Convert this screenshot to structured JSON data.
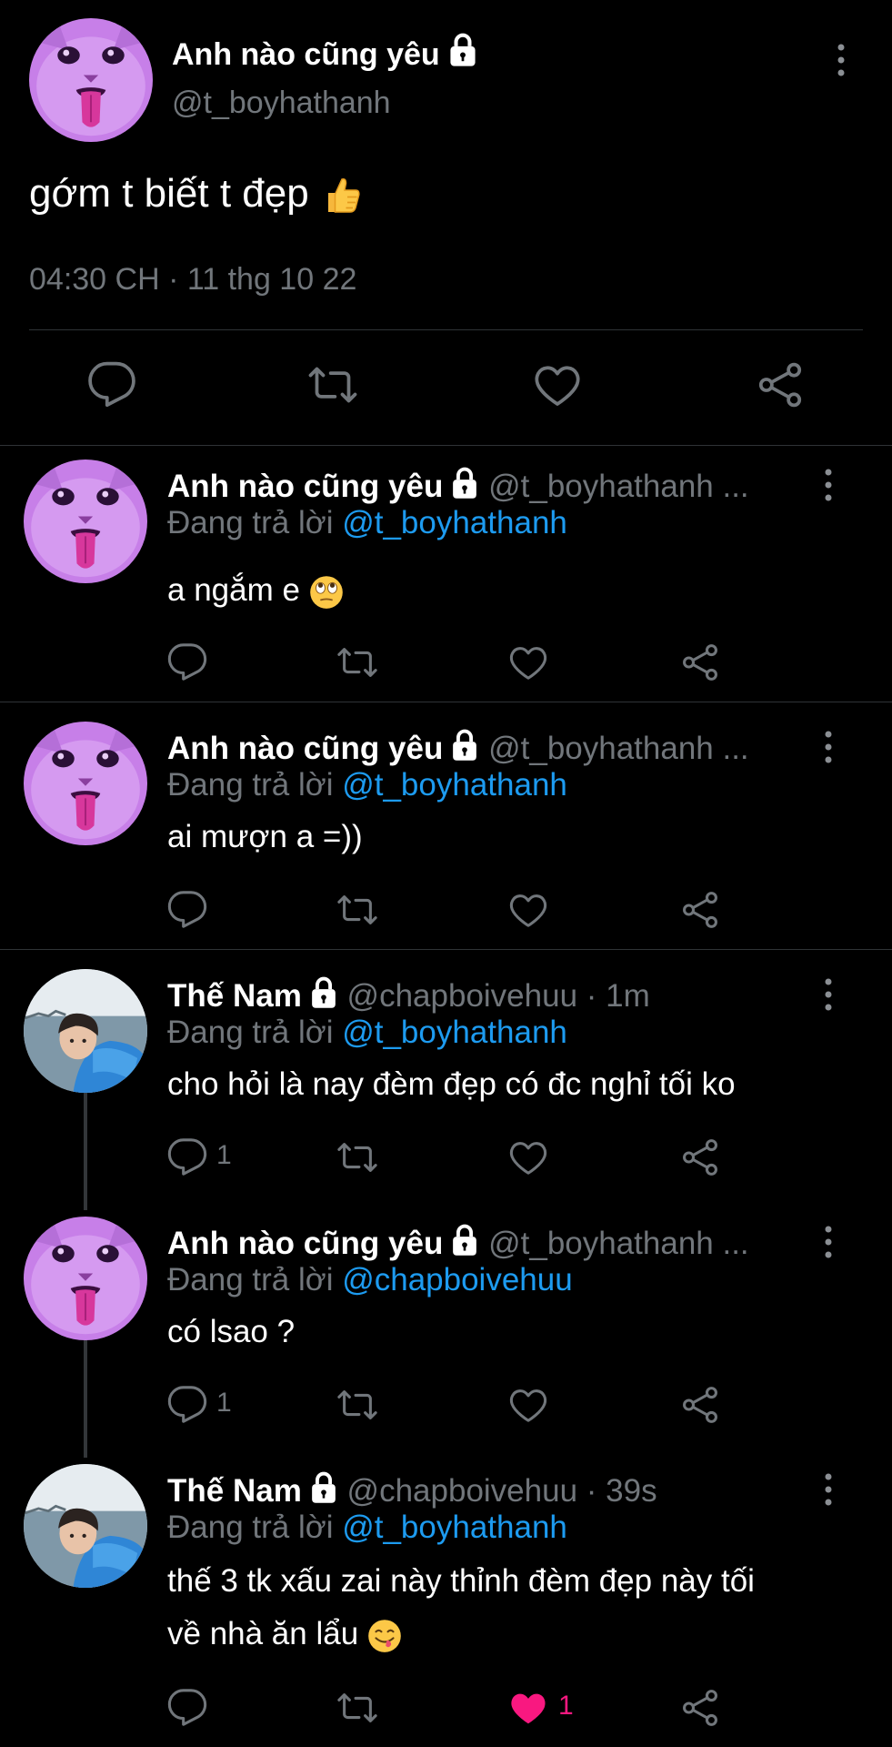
{
  "main_tweet": {
    "display_name": "Anh nào cũng yêu",
    "handle": "@t_boyhathanh",
    "text": "gớm t biết t đẹp",
    "timestamp": "04:30 CH · 11 thg 10 22",
    "actions": [
      "reply-icon",
      "retweet-icon",
      "like-icon",
      "share-icon"
    ]
  },
  "replies": [
    {
      "display_name": "Anh nào cũng yêu",
      "handle_meta": "@t_boyhathanh ...",
      "replying_prefix": "Đang trả lời",
      "replying_to": "@t_boyhathanh",
      "text": "a ngắm e",
      "reply_count": "",
      "like_count": ""
    },
    {
      "display_name": "Anh nào cũng yêu",
      "handle_meta": "@t_boyhathanh ...",
      "replying_prefix": "Đang trả lời",
      "replying_to": "@t_boyhathanh",
      "text": "ai mượn a =))",
      "reply_count": "",
      "like_count": ""
    },
    {
      "display_name": "Thế Nam",
      "handle_meta": "@chapboivehuu · 1m",
      "replying_prefix": "Đang trả lời",
      "replying_to": "@t_boyhathanh",
      "text": "cho hỏi là nay đèm đẹp có đc nghỉ tối ko",
      "reply_count": "1",
      "like_count": ""
    },
    {
      "display_name": "Anh nào cũng yêu",
      "handle_meta": "@t_boyhathanh ...",
      "replying_prefix": "Đang trả lời",
      "replying_to": "@chapboivehuu",
      "text": "có lsao ?",
      "reply_count": "1",
      "like_count": ""
    },
    {
      "display_name": "Thế Nam",
      "handle_meta": "@chapboivehuu · 39s",
      "replying_prefix": "Đang trả lời",
      "replying_to": "@t_boyhathanh",
      "text_line1": "thế 3 tk xấu zai này thỉnh đèm đẹp này tối",
      "text_line2": "về nhà ăn lẩu",
      "reply_count": "",
      "like_count": "1",
      "liked": true
    }
  ],
  "colors": {
    "background": "#000000",
    "text": "#ffffff",
    "secondary": "#71767b",
    "link": "#1d9bf0",
    "like": "#f91880",
    "divider": "#2f3336"
  }
}
